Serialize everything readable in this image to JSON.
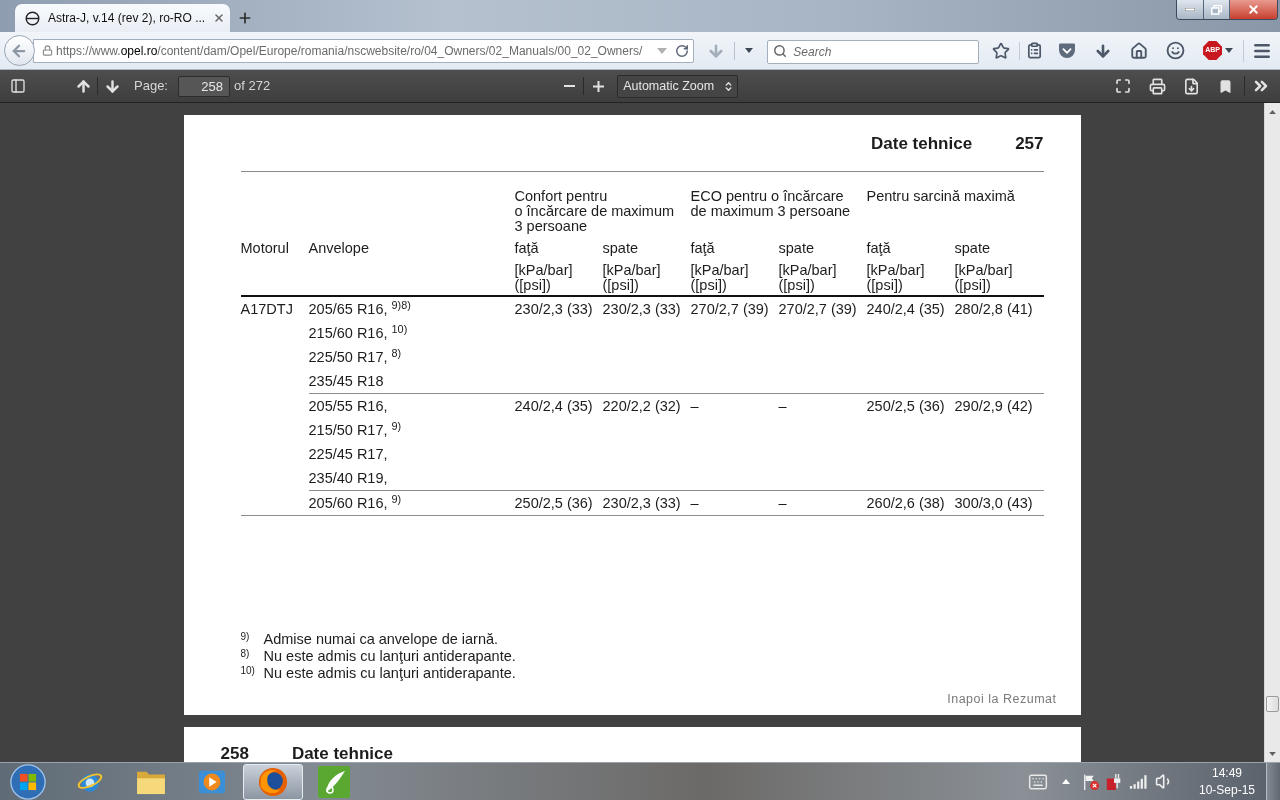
{
  "browser": {
    "tabs": [
      {
        "title": "Astra-J, v.14 (rev 2), ro-RO ...",
        "selected": true
      }
    ],
    "nav": {
      "url_prefix": "https://www.",
      "url_domain": "opel.ro",
      "url_path": "/content/dam/Opel/Europe/romania/nscwebsite/ro/04_Owners/02_Manuals/00_02_Owners/",
      "search_placeholder": "Search",
      "adblock_label": "ABP"
    }
  },
  "pdf_toolbar": {
    "page_label": "Page:",
    "page_value": "258",
    "page_count": "of 272",
    "zoom": "Automatic Zoom"
  },
  "page": {
    "title": "Date tehnice",
    "number": "257",
    "table": {
      "groups": [
        "Confort pentru\no încărcare de maximum\n3 persoane",
        "ECO pentru o încărcare\nde maximum 3 persoane",
        "Pentru sarcină maximă"
      ],
      "columns": [
        "Motorul",
        "Anvelope",
        "faţă",
        "spate",
        "faţă",
        "spate",
        "faţă",
        "spate"
      ],
      "units": [
        "[kPa/bar]\n([psi])",
        "[kPa/bar]\n([psi])",
        "[kPa/bar]\n([psi])",
        "[kPa/bar]\n([psi])",
        "[kPa/bar]\n([psi])",
        "[kPa/bar]\n([psi])"
      ],
      "rows": [
        {
          "engine": "A17DTJ",
          "groups": [
            {
              "tires": [
                "205/65 R16, $^{9)8)}$",
                "215/60 R16, $^{10)}$",
                "225/50 R17, $^{8)}$",
                "235/45 R18"
              ],
              "values": [
                "230/2,3 (33)",
                "230/2,3 (33)",
                "270/2,7 (39)",
                "270/2,7 (39)",
                "240/2,4 (35)",
                "280/2,8 (41)"
              ]
            },
            {
              "tires": [
                "205/55 R16,",
                "215/50 R17, $^{9)}$",
                "225/45 R17,",
                "235/40 R19,"
              ],
              "values": [
                "240/2,4 (35)",
                "220/2,2 (32)",
                "–",
                "–",
                "250/2,5 (36)",
                "290/2,9 (42)"
              ]
            },
            {
              "tires": [
                "205/60 R16, $^{9)}$"
              ],
              "values": [
                "250/2,5 (36)",
                "230/2,3 (33)",
                "–",
                "–",
                "260/2,6 (38)",
                "300/3,0 (43)"
              ]
            }
          ]
        }
      ]
    },
    "footnotes": [
      {
        "mark": "9)",
        "text": "Admise numai ca anvelope de iarnă."
      },
      {
        "mark": "8)",
        "text": "Nu este admis cu lanţuri antiderapante."
      },
      {
        "mark": "10)",
        "text": "Nu este admis cu lanţuri antiderapante."
      }
    ],
    "back_link": "Inapoi la Rezumat"
  },
  "next_page": {
    "number": "258",
    "title": "Date tehnice"
  },
  "taskbar": {
    "apps": [
      {
        "kind": "globe",
        "selected": false
      },
      {
        "kind": "folder",
        "selected": false
      },
      {
        "kind": "player",
        "selected": false
      },
      {
        "kind": "browser",
        "selected": true
      },
      {
        "kind": "leaf",
        "selected": false
      }
    ],
    "time": "14:49",
    "date": "10-Sep-15"
  }
}
